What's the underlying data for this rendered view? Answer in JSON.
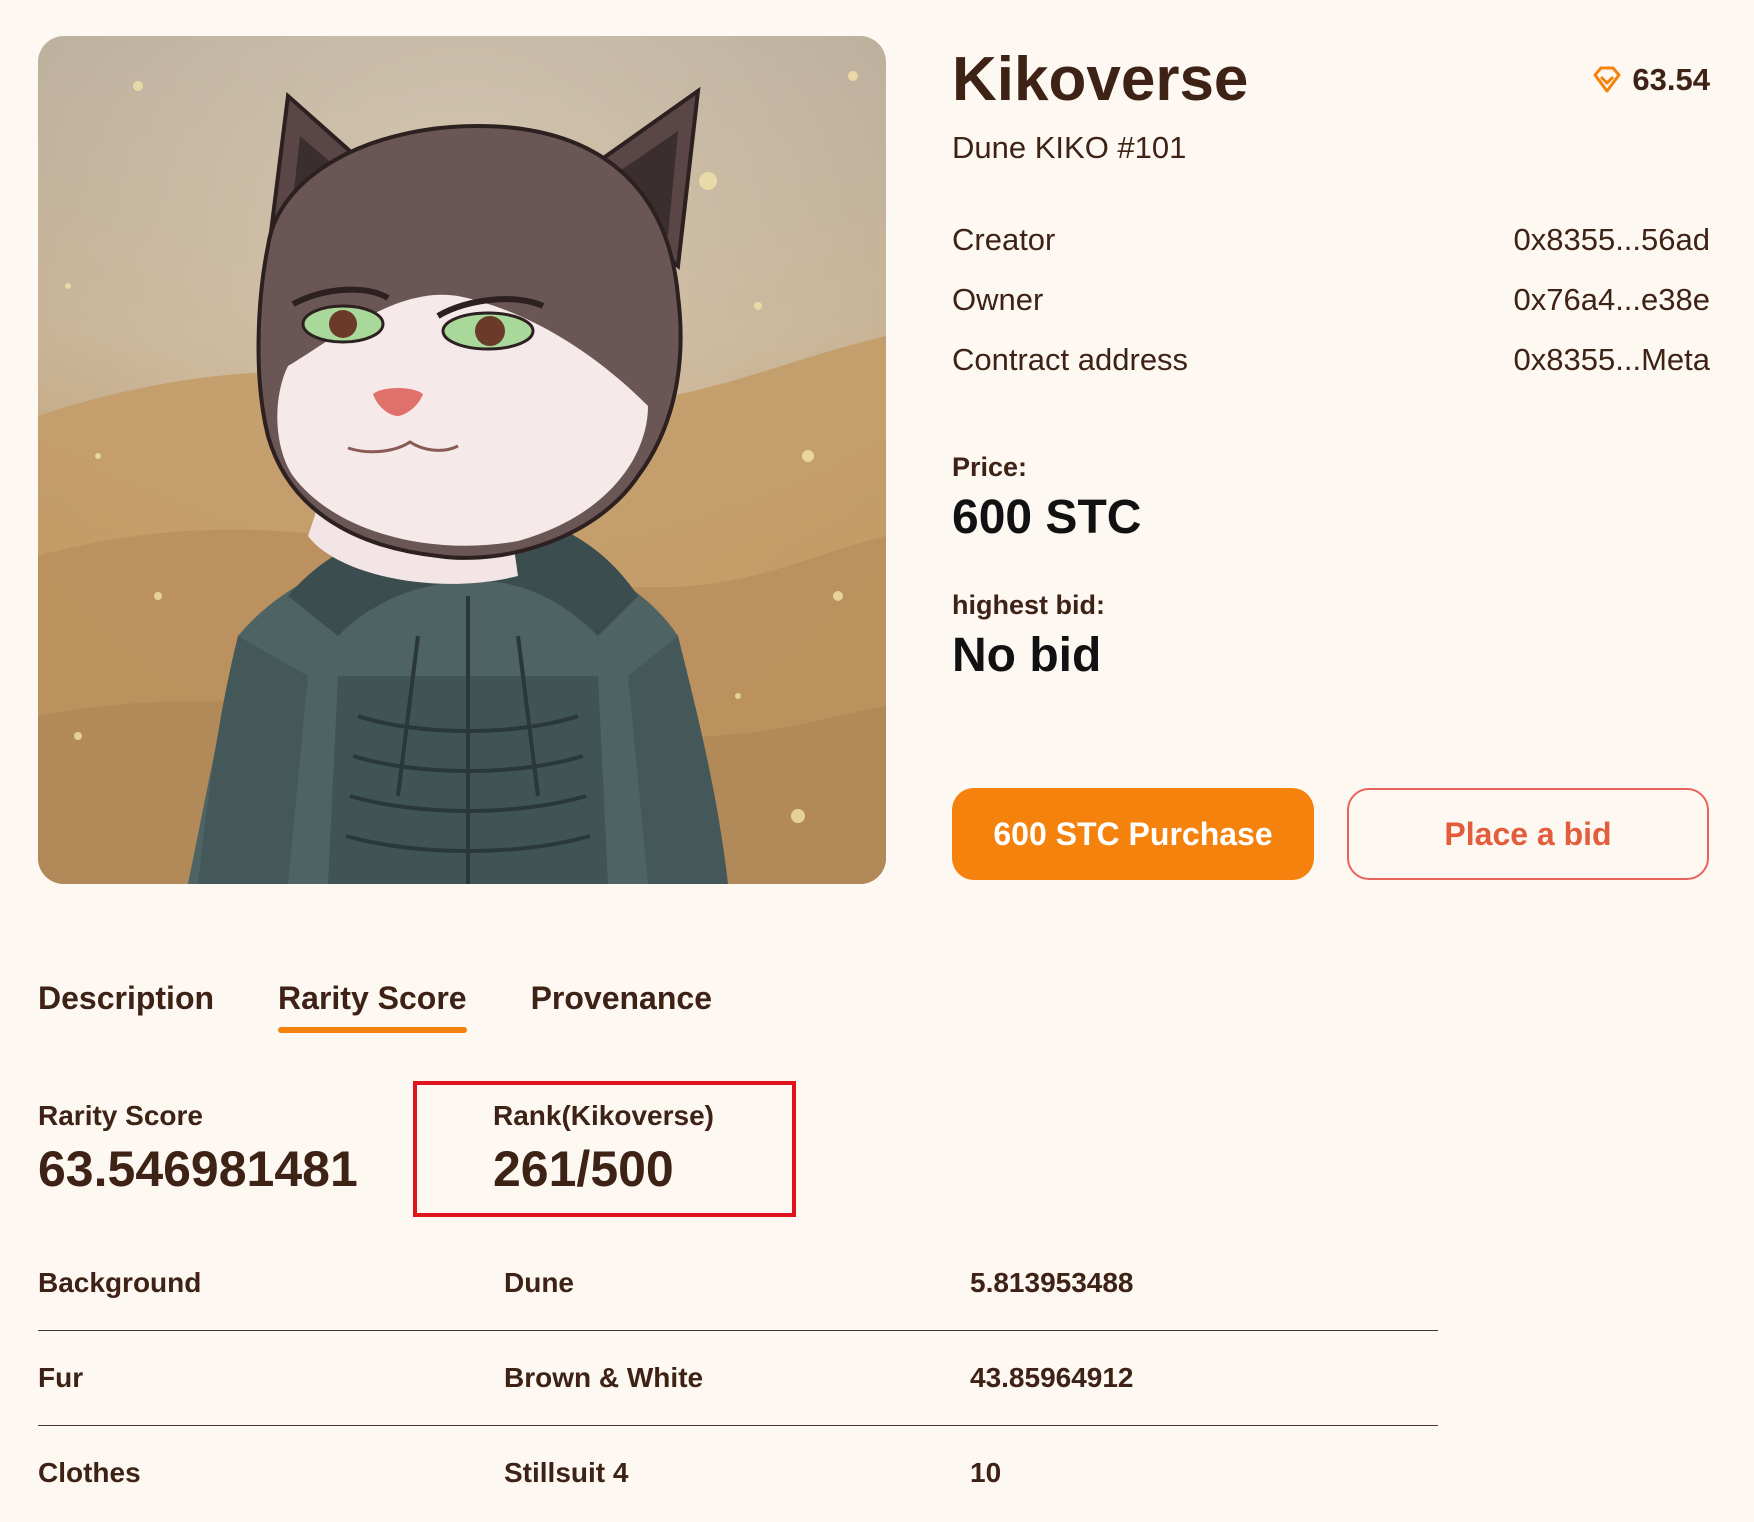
{
  "nft": {
    "collection": "Kikoverse",
    "name": "Dune KIKO #101",
    "score": "63.54",
    "image_alt": "Cat character in dark stillsuit"
  },
  "details": [
    {
      "label": "Creator",
      "value": "0x8355...56ad"
    },
    {
      "label": "Owner",
      "value": "0x76a4...e38e"
    },
    {
      "label": "Contract address",
      "value": "0x8355...Meta"
    }
  ],
  "pricing": {
    "price_label": "Price:",
    "price_value": "600 STC",
    "bid_label": "highest bid:",
    "bid_value": "No bid"
  },
  "actions": {
    "purchase_label": "600 STC Purchase",
    "bid_label": "Place a bid"
  },
  "tabs": [
    {
      "label": "Description",
      "active": false
    },
    {
      "label": "Rarity Score",
      "active": true
    },
    {
      "label": "Provenance",
      "active": false
    }
  ],
  "rarity": {
    "score_label": "Rarity Score",
    "score_value": "63.546981481",
    "rank_label": "Rank(Kikoverse)",
    "rank_value": "261/500"
  },
  "traits": [
    {
      "type": "Background",
      "value": "Dune",
      "score": "5.813953488"
    },
    {
      "type": "Fur",
      "value": "Brown & White",
      "score": "43.85964912"
    },
    {
      "type": "Clothes",
      "value": "Stillsuit 4",
      "score": "10"
    }
  ],
  "colors": {
    "background": "#fdf8f2",
    "text": "#3d2215",
    "accent": "#f5820d",
    "bid_outline": "#e8635a",
    "highlight": "#e0141c"
  },
  "icons": {
    "score": "gem-icon"
  }
}
